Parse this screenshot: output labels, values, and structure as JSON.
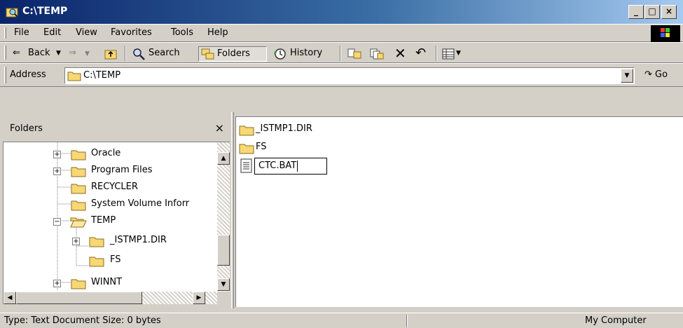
{
  "window": {
    "title": "C:\\TEMP"
  },
  "window_buttons": [
    "_",
    "□",
    "×"
  ],
  "menu": [
    "File",
    "Edit",
    "View",
    "Favorites",
    "Tools",
    "Help"
  ],
  "toolbar": {
    "back_label": "Back",
    "search_label": "Search",
    "folders_label": "Folders",
    "history_label": "History"
  },
  "address": {
    "label": "Address",
    "value": "C:\\TEMP",
    "go_label": "Go"
  },
  "folders_pane": {
    "title": "Folders",
    "close_symbol": "×",
    "items": [
      {
        "label": "Oracle",
        "expander": "+"
      },
      {
        "label": "Program Files",
        "expander": "+"
      },
      {
        "label": "RECYCLER",
        "expander": ""
      },
      {
        "label": "System Volume Inforr",
        "expander": ""
      },
      {
        "label": "TEMP",
        "expander": "−"
      },
      {
        "label": "_ISTMP1.DIR",
        "expander": "+"
      },
      {
        "label": "FS",
        "expander": ""
      },
      {
        "label": "WINNT",
        "expander": "+"
      }
    ]
  },
  "files": [
    {
      "name": "_ISTMP1.DIR",
      "type": "folder"
    },
    {
      "name": "FS",
      "type": "folder"
    },
    {
      "name": "CTC.BAT",
      "type": "text",
      "renaming": true
    }
  ],
  "status": {
    "left": "Type: Text Document Size: 0 bytes",
    "right": "My Computer"
  },
  "colors": {
    "titlebar_start": "#0a246a",
    "titlebar_end": "#a6caf0",
    "folder": "#f8d775",
    "face": "#d4d0c8"
  }
}
